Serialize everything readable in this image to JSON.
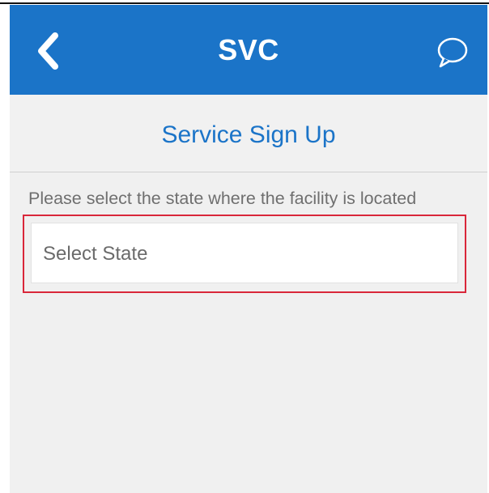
{
  "app_bar": {
    "title": "SVC",
    "back_icon": "chevron-left-icon",
    "chat_icon": "chat-bubble-icon",
    "background_color": "#1b74c8",
    "foreground_color": "#ffffff"
  },
  "page": {
    "title": "Service Sign Up",
    "title_color": "#1b74c8",
    "instruction": "Please select the state where the facility is located"
  },
  "state_field": {
    "placeholder": "Select State",
    "highlight_color": "#d9273a"
  }
}
